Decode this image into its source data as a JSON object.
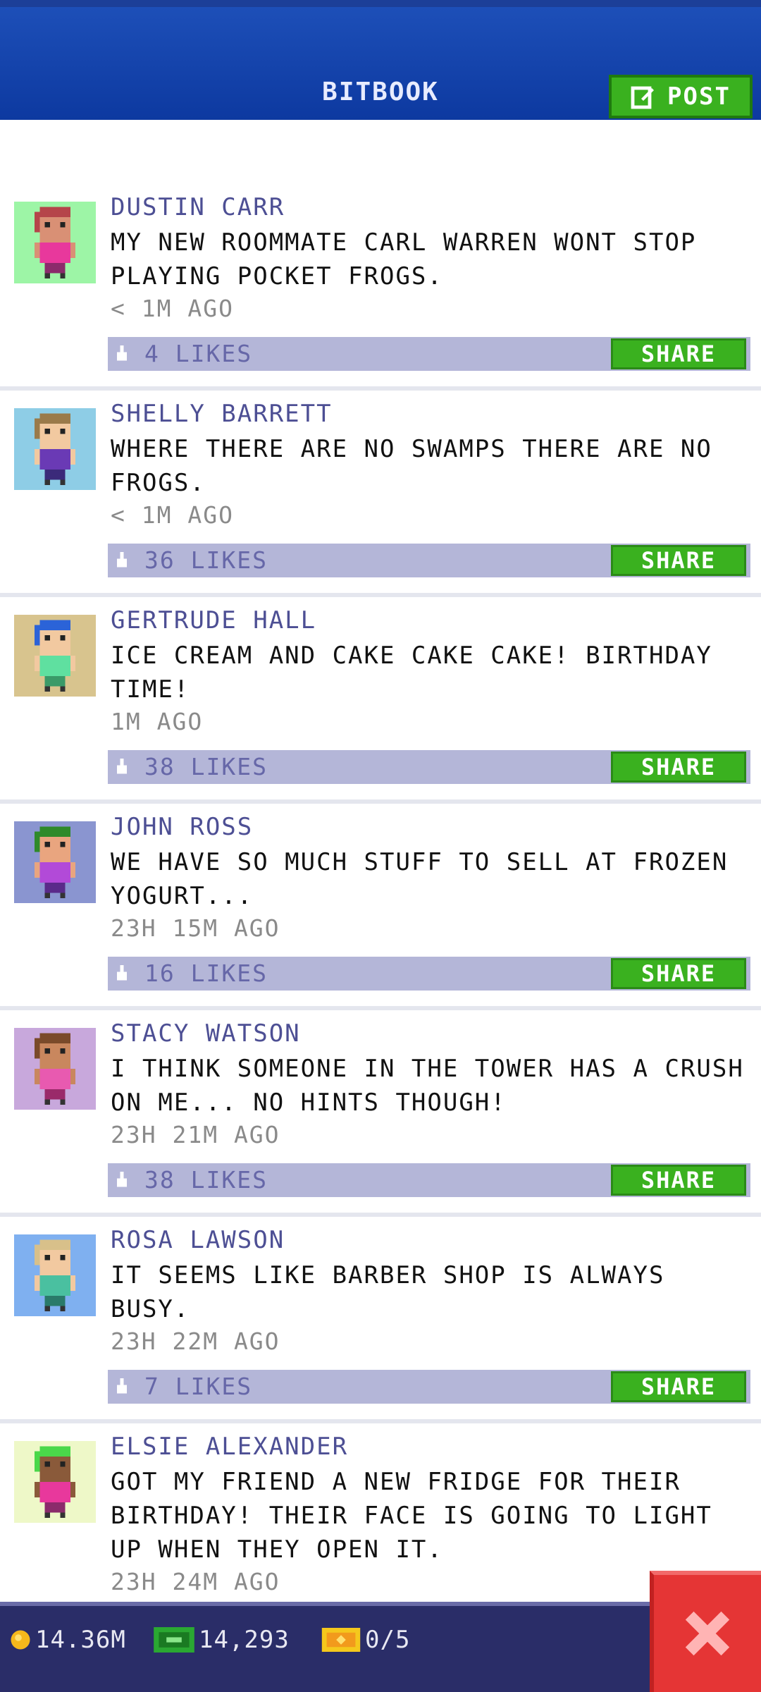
{
  "header": {
    "title": "BITBOOK",
    "post_label": "POST"
  },
  "posts": [
    {
      "name": "DUSTIN CARR",
      "text": "MY NEW ROOMMATE CARL WARREN WONT STOP PLAYING POCKET FROGS.",
      "time": "< 1M AGO",
      "likes": "4 LIKES",
      "share": "SHARE",
      "avatar_bg": "#9df5a6",
      "skin": "#d99075",
      "hair": "#b5454a",
      "shirt": "#e8389c",
      "pants": "#8b2b6b"
    },
    {
      "name": "SHELLY BARRETT",
      "text": "WHERE THERE ARE NO SWAMPS THERE ARE NO FROGS.",
      "time": "< 1M AGO",
      "likes": "36 LIKES",
      "share": "SHARE",
      "avatar_bg": "#8ecde6",
      "skin": "#f2c9a0",
      "hair": "#9a7a4a",
      "shirt": "#6a3ab5",
      "pants": "#3b2a7a"
    },
    {
      "name": "GERTRUDE HALL",
      "text": "ICE CREAM AND CAKE CAKE CAKE! BIRTHDAY TIME!",
      "time": "1M AGO",
      "likes": "38 LIKES",
      "share": "SHARE",
      "avatar_bg": "#d8c48e",
      "skin": "#f2c9a0",
      "hair": "#2b63d8",
      "shirt": "#5fe0a0",
      "pants": "#3a9a68"
    },
    {
      "name": "JOHN ROSS",
      "text": "WE HAVE SO MUCH STUFF TO SELL AT FROZEN YOGURT...",
      "time": "23H 15M AGO",
      "likes": "16 LIKES",
      "share": "SHARE",
      "avatar_bg": "#8a95d0",
      "skin": "#e9a57f",
      "hair": "#2f8a2a",
      "shirt": "#b24ad8",
      "pants": "#5a2a8a"
    },
    {
      "name": "STACY WATSON",
      "text": "I THINK SOMEONE IN THE TOWER HAS A CRUSH ON ME... NO HINTS THOUGH!",
      "time": "23H 21M AGO",
      "likes": "38 LIKES",
      "share": "SHARE",
      "avatar_bg": "#c8a8dc",
      "skin": "#c9875e",
      "hair": "#7a4a2a",
      "shirt": "#e85ab0",
      "pants": "#9a2a6a"
    },
    {
      "name": "ROSA LAWSON",
      "text": "IT SEEMS LIKE BARBER SHOP IS ALWAYS BUSY.",
      "time": "23H 22M AGO",
      "likes": "7 LIKES",
      "share": "SHARE",
      "avatar_bg": "#7fb0f0",
      "skin": "#f2c9a0",
      "hair": "#d8c08a",
      "shirt": "#4ac0a0",
      "pants": "#2a7a6a"
    },
    {
      "name": "ELSIE ALEXANDER",
      "text": "GOT MY FRIEND A NEW FRIDGE FOR THEIR BIRTHDAY! THEIR FACE IS GOING TO LIGHT UP WHEN THEY OPEN IT.",
      "time": "23H 24M AGO",
      "likes": "",
      "share": "",
      "avatar_bg": "#eef8c8",
      "skin": "#8a5a3a",
      "hair": "#4ad84a",
      "shirt": "#e8389c",
      "pants": "#8b2b6b"
    }
  ],
  "status": {
    "coins": "14.36M",
    "bux": "14,293",
    "tickets": "0/5"
  },
  "colors": {
    "accent_green": "#3ab11f",
    "header_blue": "#1d4fb8",
    "close_red": "#e53535",
    "name_color": "#4d4f94"
  }
}
